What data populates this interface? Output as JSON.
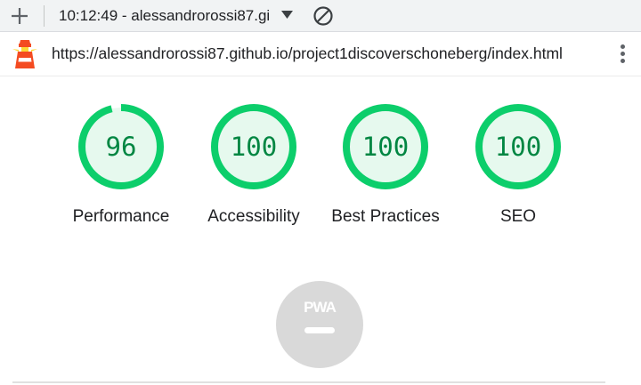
{
  "toolbar": {
    "report_title": "10:12:49 - alessandrorossi87.gi",
    "icons": [
      "plus-icon",
      "dropdown-arrow-icon",
      "block-icon"
    ]
  },
  "urlbar": {
    "url": "https://alessandrorossi87.github.io/project1discoverschoneberg/index.html",
    "icons": [
      "lighthouse-icon",
      "kebab-menu-icon"
    ]
  },
  "gauges": [
    {
      "score": "96",
      "label": "Performance",
      "fraction": 0.96
    },
    {
      "score": "100",
      "label": "Accessibility",
      "fraction": 1.0
    },
    {
      "score": "100",
      "label": "Best Practices",
      "fraction": 1.0
    },
    {
      "score": "100",
      "label": "SEO",
      "fraction": 1.0
    }
  ],
  "pwa": {
    "text": "PWA",
    "state": "not-applicable"
  },
  "colors": {
    "pass_stroke": "#0cce6b",
    "pass_fill": "#e6f9ee",
    "pass_text": "#018642",
    "pwa_gray": "#d9d9d9",
    "lighthouse_orange": "#f44b21"
  }
}
